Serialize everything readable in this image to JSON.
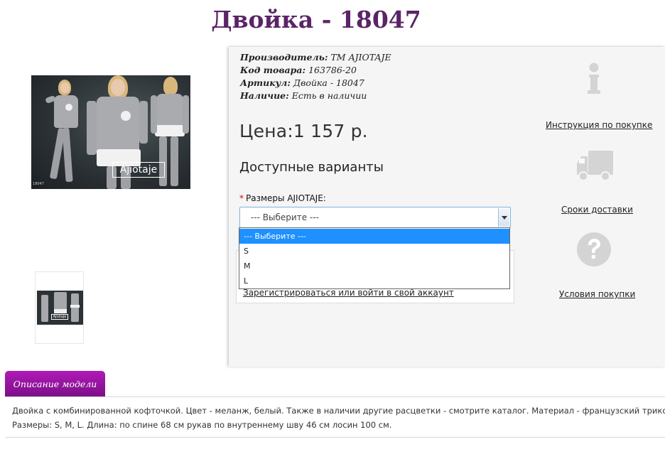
{
  "product": {
    "title": "Двойка - 18047",
    "price": "Цена:1 157 р."
  },
  "meta": {
    "manufacturer_label": "Производитель:",
    "manufacturer_value": "ТМ AJIOTAJE",
    "code_label": "Код товара:",
    "code_value": "163786-20",
    "article_label": "Артикул:",
    "article_value": "Двойка - 18047",
    "stock_label": "Наличие:",
    "stock_value": "Есть в наличии"
  },
  "image": {
    "logo_text": "Ajiotaje",
    "code": "18047"
  },
  "variants": {
    "title": "Доступные варианты",
    "required_mark": "*",
    "size_label": "Размеры AJIOTAJE:",
    "selected": "--- Выберите ---",
    "options": [
      "--- Выберите ---",
      "S",
      "M",
      "L"
    ]
  },
  "account": {
    "register_link": "Зарегистрироваться или войти в свой аккаунт"
  },
  "sidebar": {
    "instruction": "Инструкция по покупке",
    "delivery": "Сроки доставки",
    "terms": "Условия покупки"
  },
  "description": {
    "tab_label": "Описание модели",
    "line1": "Двойка с комбинированной кофточкой. Цвет - меланж, белый. Также в наличии другие расцветки - смотрите каталог. Материал - французский трикотаж.",
    "line2": "Размеры: S, M, L. Длина: по спине 68 см рукав по внутреннему шву 46 см лосин 100 см."
  },
  "colors": {
    "title": "#5a2467",
    "tab": "#9a18a5",
    "dropdown_selected": "#1e90ff",
    "icon_gray": "#d4d4d4"
  }
}
